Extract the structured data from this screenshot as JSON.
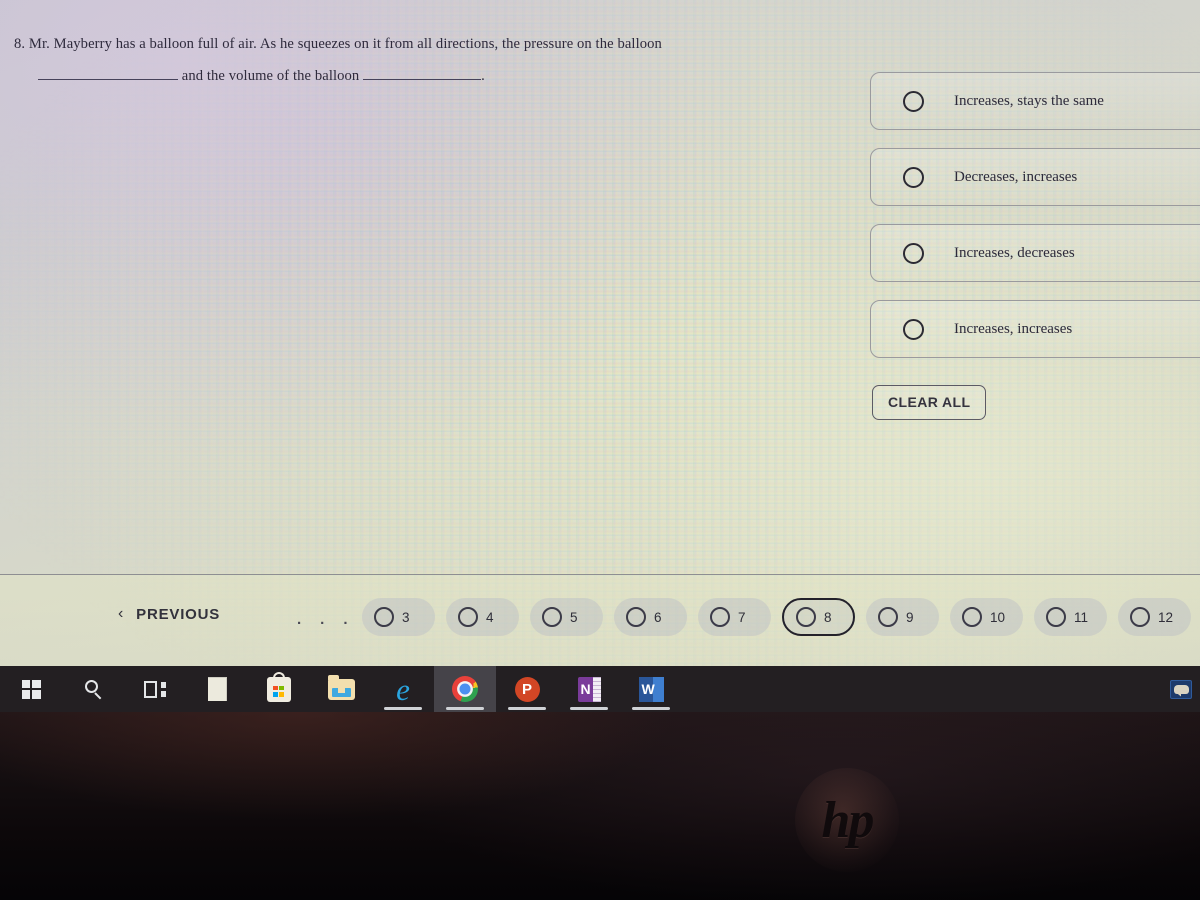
{
  "question": {
    "number": "8.",
    "line1": "Mr. Mayberry has a balloon full of air.  As he squeezes on it from all directions, the pressure on the balloon",
    "line2_mid": "and the volume of the balloon",
    "line2_end": "."
  },
  "options": [
    {
      "label": "Increases, stays the same",
      "selected": false
    },
    {
      "label": "Decreases, increases",
      "selected": false
    },
    {
      "label": "Increases, decreases",
      "selected": false
    },
    {
      "label": "Increases, increases",
      "selected": false
    }
  ],
  "clear_all_label": "CLEAR ALL",
  "nav": {
    "previous_label": "PREVIOUS",
    "previous_chevron": "‹",
    "ellipsis": "· · ·",
    "pages": [
      "3",
      "4",
      "5",
      "6",
      "7",
      "8",
      "9",
      "10",
      "11",
      "12"
    ],
    "current_page": "8"
  },
  "taskbar": {
    "items": [
      {
        "name": "start",
        "label": "Start"
      },
      {
        "name": "search",
        "label": "Search"
      },
      {
        "name": "task-view",
        "label": "Task View"
      },
      {
        "name": "document",
        "label": "Document"
      },
      {
        "name": "microsoft-store",
        "label": "Microsoft Store"
      },
      {
        "name": "file-explorer",
        "label": "File Explorer"
      },
      {
        "name": "edge",
        "label": "Microsoft Edge",
        "glyph": "e"
      },
      {
        "name": "chrome",
        "label": "Google Chrome",
        "active": true
      },
      {
        "name": "powerpoint",
        "label": "PowerPoint",
        "glyph": "P"
      },
      {
        "name": "onenote",
        "label": "OneNote",
        "glyph": "N"
      },
      {
        "name": "word",
        "label": "Word",
        "glyph": "W"
      }
    ],
    "tray_icon": "notification-bubble-icon"
  },
  "device": {
    "brand": "hp"
  },
  "colors": {
    "taskbar_bg": "#231f22",
    "bezel": "#0b0709",
    "text": "#2d2a3a",
    "radio_outline": "#2b2a33"
  }
}
